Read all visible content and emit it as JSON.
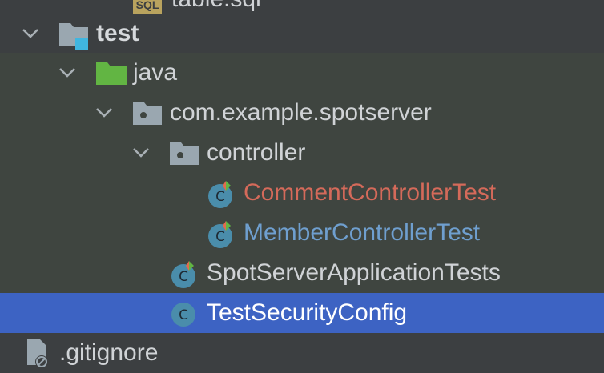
{
  "top_partial": {
    "icon": "sql-file-icon",
    "badge": "SQL",
    "label": "table.sql"
  },
  "tree": {
    "test": {
      "label": "test",
      "icon": "test-root-folder-icon",
      "expanded": true
    },
    "java": {
      "label": "java",
      "icon": "test-sources-folder-icon",
      "expanded": true
    },
    "package": {
      "label": "com.example.spotserver",
      "icon": "package-icon",
      "expanded": true
    },
    "controller": {
      "label": "controller",
      "icon": "package-icon",
      "expanded": true
    },
    "files": [
      {
        "label": "CommentControllerTest",
        "icon": "test-class-icon",
        "status": "changed",
        "color": "#d56a5a"
      },
      {
        "label": "MemberControllerTest",
        "icon": "test-class-icon",
        "status": "modified",
        "color": "#6f9fcf"
      },
      {
        "label": "SpotServerApplicationTests",
        "icon": "test-class-icon",
        "status": "normal"
      },
      {
        "label": "TestSecurityConfig",
        "icon": "class-icon",
        "status": "selected"
      }
    ],
    "gitignore": {
      "label": ".gitignore",
      "icon": "ignored-file-icon"
    }
  },
  "colors": {
    "background": "#3c3f41",
    "test_scope": "#3f4540",
    "selection": "#3d63c3",
    "class_icon": "#4a8dab"
  }
}
